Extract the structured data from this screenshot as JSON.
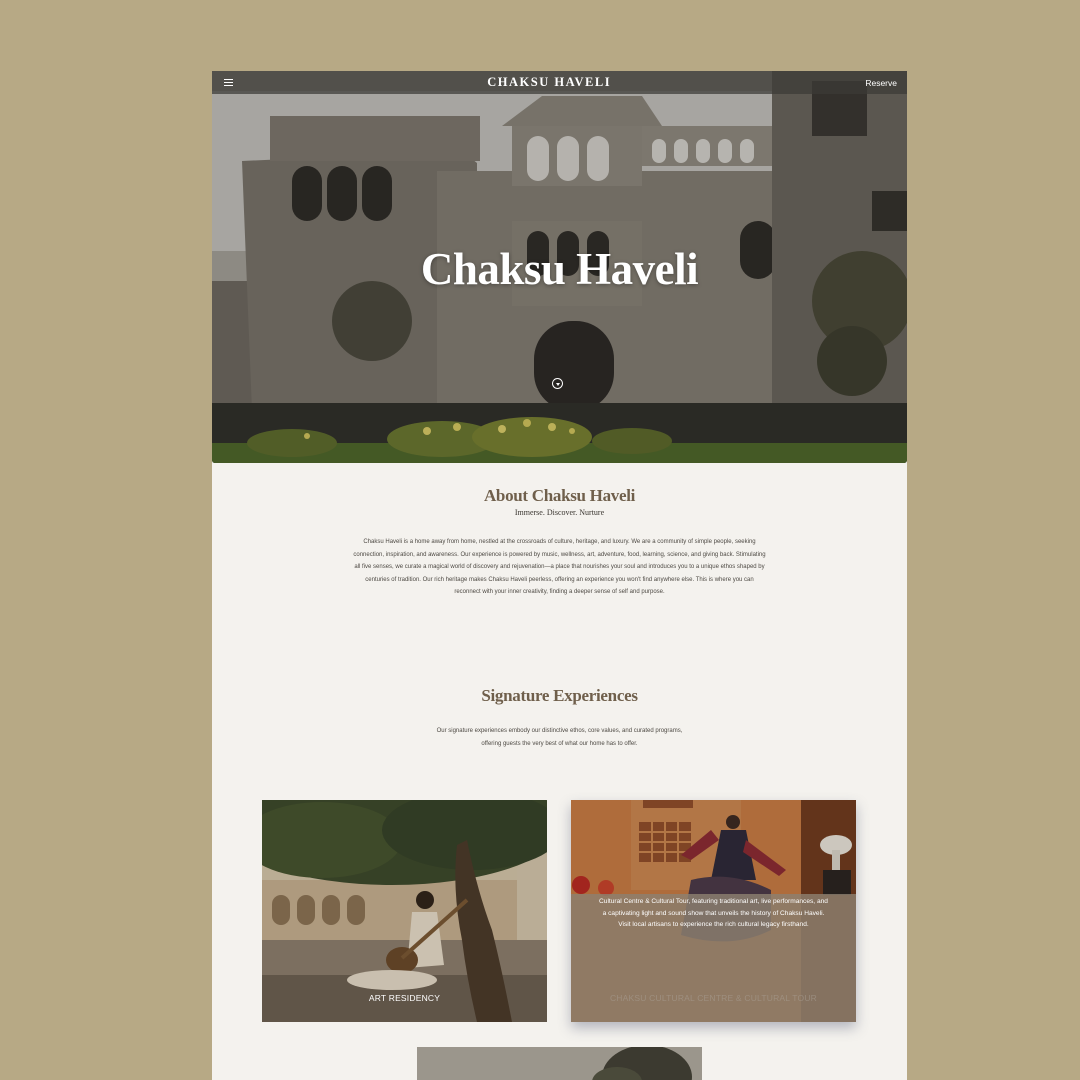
{
  "header": {
    "menu_icon": "hamburger-menu-icon",
    "brand": "CHAKSU HAVELI",
    "reserve_label": "Reserve"
  },
  "hero": {
    "title": "Chaksu Haveli",
    "scroll_icon": "chevron-down-circle-icon"
  },
  "about": {
    "title": "About Chaksu Haveli",
    "subtitle": "Immerse. Discover. Nurture",
    "body": "Chaksu Haveli is a home away from home, nestled at the crossroads of culture, heritage, and luxury. We are a community of simple people, seeking connection, inspiration, and awareness. Our experience is powered by music, wellness, art, adventure, food, learning, science, and giving back. Stimulating all five senses, we curate a magical world of discovery and rejuvenation—a place that nourishes your soul and introduces you to a unique ethos shaped by centuries of tradition. Our rich heritage makes Chaksu Haveli peerless, offering an experience you won't find anywhere else. This is where you can reconnect with your inner creativity, finding a deeper sense of self and purpose."
  },
  "signature": {
    "title": "Signature Experiences",
    "body": "Our signature experiences embody our distinctive ethos, core values, and curated programs, offering guests the very best of what our home has to offer."
  },
  "cards": [
    {
      "label": "ART RESIDENCY"
    },
    {
      "label": "CHAKSU CULTURAL CENTRE & CULTURAL TOUR",
      "description": "Cultural Centre & Cultural Tour, featuring traditional art, live performances, and a captivating light and sound show that unveils the history of Chaksu Haveli. Visit local artisans to experience the rich cultural legacy firsthand."
    }
  ],
  "colors": {
    "page_background": "#b7a985",
    "content_background": "#f4f2ee",
    "heading_accent": "#6f5f4b"
  }
}
